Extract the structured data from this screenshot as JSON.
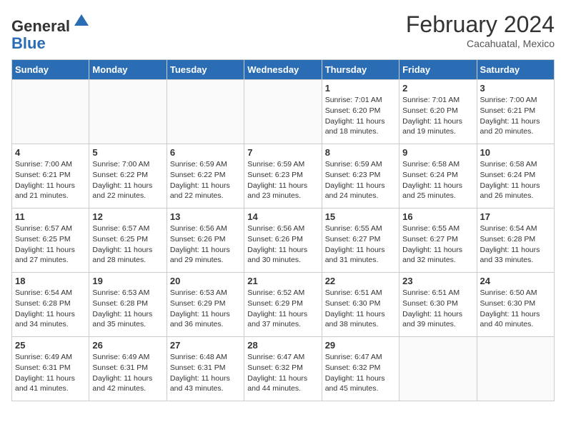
{
  "header": {
    "logo_general": "General",
    "logo_blue": "Blue",
    "month_title": "February 2024",
    "location": "Cacahuatal, Mexico"
  },
  "days_of_week": [
    "Sunday",
    "Monday",
    "Tuesday",
    "Wednesday",
    "Thursday",
    "Friday",
    "Saturday"
  ],
  "weeks": [
    [
      {
        "day": "",
        "info": ""
      },
      {
        "day": "",
        "info": ""
      },
      {
        "day": "",
        "info": ""
      },
      {
        "day": "",
        "info": ""
      },
      {
        "day": "1",
        "info": "Sunrise: 7:01 AM\nSunset: 6:20 PM\nDaylight: 11 hours\nand 18 minutes."
      },
      {
        "day": "2",
        "info": "Sunrise: 7:01 AM\nSunset: 6:20 PM\nDaylight: 11 hours\nand 19 minutes."
      },
      {
        "day": "3",
        "info": "Sunrise: 7:00 AM\nSunset: 6:21 PM\nDaylight: 11 hours\nand 20 minutes."
      }
    ],
    [
      {
        "day": "4",
        "info": "Sunrise: 7:00 AM\nSunset: 6:21 PM\nDaylight: 11 hours\nand 21 minutes."
      },
      {
        "day": "5",
        "info": "Sunrise: 7:00 AM\nSunset: 6:22 PM\nDaylight: 11 hours\nand 22 minutes."
      },
      {
        "day": "6",
        "info": "Sunrise: 6:59 AM\nSunset: 6:22 PM\nDaylight: 11 hours\nand 22 minutes."
      },
      {
        "day": "7",
        "info": "Sunrise: 6:59 AM\nSunset: 6:23 PM\nDaylight: 11 hours\nand 23 minutes."
      },
      {
        "day": "8",
        "info": "Sunrise: 6:59 AM\nSunset: 6:23 PM\nDaylight: 11 hours\nand 24 minutes."
      },
      {
        "day": "9",
        "info": "Sunrise: 6:58 AM\nSunset: 6:24 PM\nDaylight: 11 hours\nand 25 minutes."
      },
      {
        "day": "10",
        "info": "Sunrise: 6:58 AM\nSunset: 6:24 PM\nDaylight: 11 hours\nand 26 minutes."
      }
    ],
    [
      {
        "day": "11",
        "info": "Sunrise: 6:57 AM\nSunset: 6:25 PM\nDaylight: 11 hours\nand 27 minutes."
      },
      {
        "day": "12",
        "info": "Sunrise: 6:57 AM\nSunset: 6:25 PM\nDaylight: 11 hours\nand 28 minutes."
      },
      {
        "day": "13",
        "info": "Sunrise: 6:56 AM\nSunset: 6:26 PM\nDaylight: 11 hours\nand 29 minutes."
      },
      {
        "day": "14",
        "info": "Sunrise: 6:56 AM\nSunset: 6:26 PM\nDaylight: 11 hours\nand 30 minutes."
      },
      {
        "day": "15",
        "info": "Sunrise: 6:55 AM\nSunset: 6:27 PM\nDaylight: 11 hours\nand 31 minutes."
      },
      {
        "day": "16",
        "info": "Sunrise: 6:55 AM\nSunset: 6:27 PM\nDaylight: 11 hours\nand 32 minutes."
      },
      {
        "day": "17",
        "info": "Sunrise: 6:54 AM\nSunset: 6:28 PM\nDaylight: 11 hours\nand 33 minutes."
      }
    ],
    [
      {
        "day": "18",
        "info": "Sunrise: 6:54 AM\nSunset: 6:28 PM\nDaylight: 11 hours\nand 34 minutes."
      },
      {
        "day": "19",
        "info": "Sunrise: 6:53 AM\nSunset: 6:28 PM\nDaylight: 11 hours\nand 35 minutes."
      },
      {
        "day": "20",
        "info": "Sunrise: 6:53 AM\nSunset: 6:29 PM\nDaylight: 11 hours\nand 36 minutes."
      },
      {
        "day": "21",
        "info": "Sunrise: 6:52 AM\nSunset: 6:29 PM\nDaylight: 11 hours\nand 37 minutes."
      },
      {
        "day": "22",
        "info": "Sunrise: 6:51 AM\nSunset: 6:30 PM\nDaylight: 11 hours\nand 38 minutes."
      },
      {
        "day": "23",
        "info": "Sunrise: 6:51 AM\nSunset: 6:30 PM\nDaylight: 11 hours\nand 39 minutes."
      },
      {
        "day": "24",
        "info": "Sunrise: 6:50 AM\nSunset: 6:30 PM\nDaylight: 11 hours\nand 40 minutes."
      }
    ],
    [
      {
        "day": "25",
        "info": "Sunrise: 6:49 AM\nSunset: 6:31 PM\nDaylight: 11 hours\nand 41 minutes."
      },
      {
        "day": "26",
        "info": "Sunrise: 6:49 AM\nSunset: 6:31 PM\nDaylight: 11 hours\nand 42 minutes."
      },
      {
        "day": "27",
        "info": "Sunrise: 6:48 AM\nSunset: 6:31 PM\nDaylight: 11 hours\nand 43 minutes."
      },
      {
        "day": "28",
        "info": "Sunrise: 6:47 AM\nSunset: 6:32 PM\nDaylight: 11 hours\nand 44 minutes."
      },
      {
        "day": "29",
        "info": "Sunrise: 6:47 AM\nSunset: 6:32 PM\nDaylight: 11 hours\nand 45 minutes."
      },
      {
        "day": "",
        "info": ""
      },
      {
        "day": "",
        "info": ""
      }
    ]
  ]
}
